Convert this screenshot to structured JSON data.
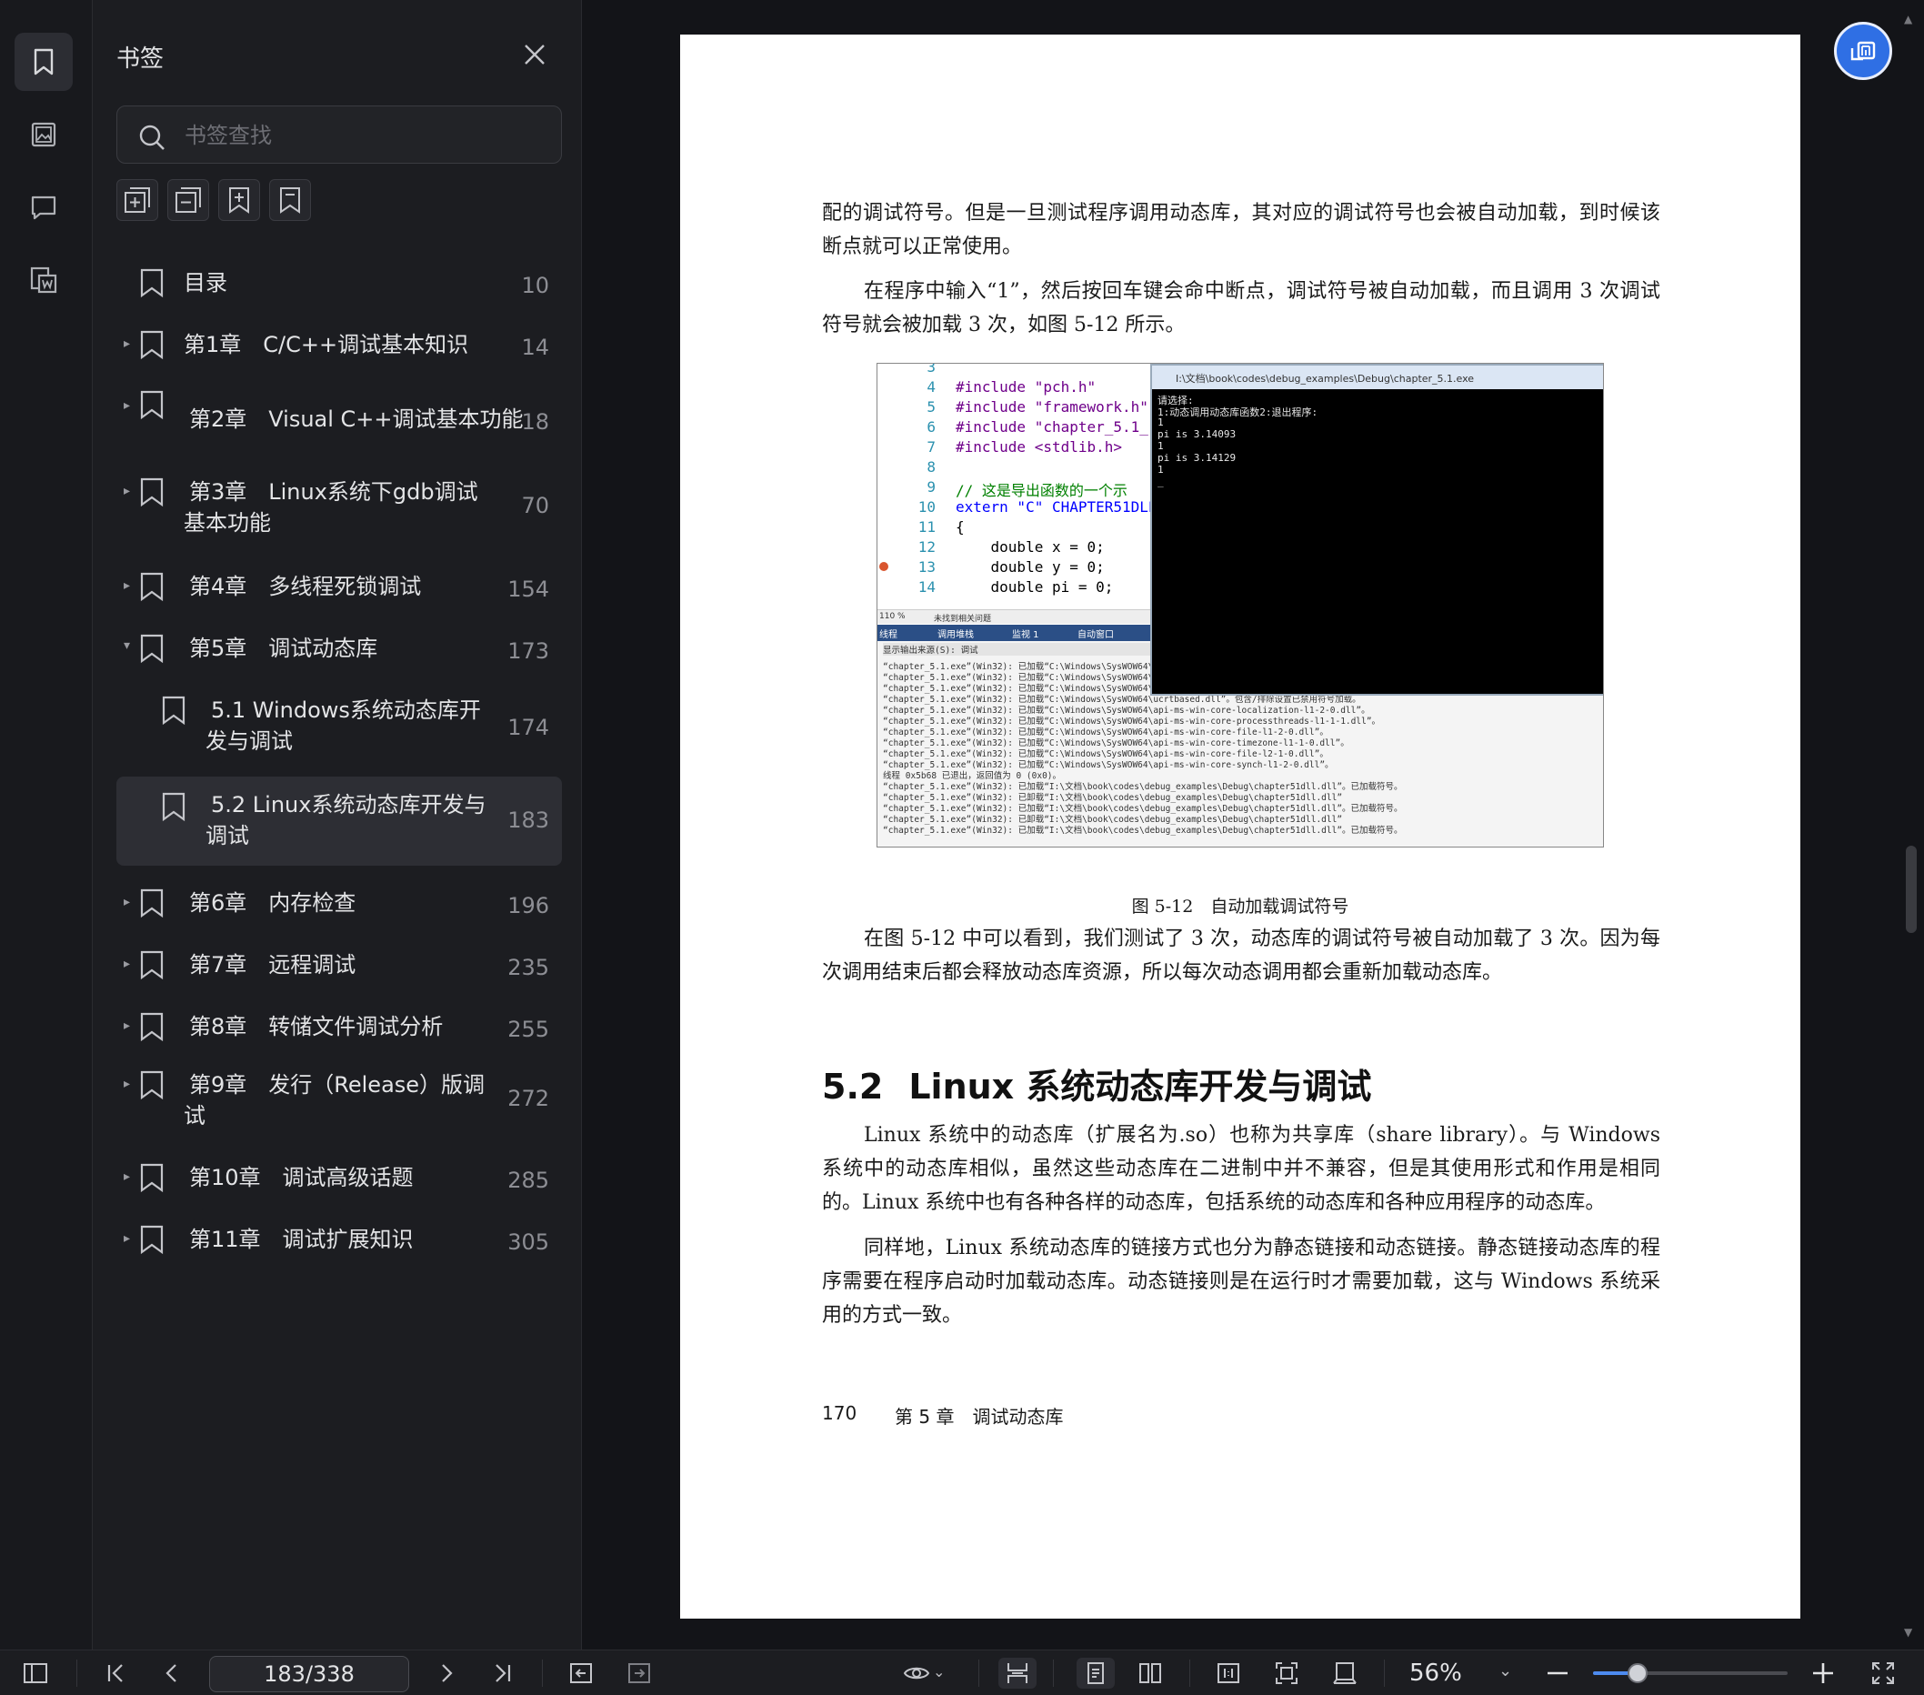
{
  "panel": {
    "title": "书签",
    "search_placeholder": "书签查找"
  },
  "bookmarks": [
    {
      "label": "目录",
      "page": "10",
      "expander": ""
    },
    {
      "label": "第1章　C/C++调试基本知识",
      "page": "14",
      "expander": "▸"
    },
    {
      "label": "第2章　Visual C++调试基本功能",
      "page": "18",
      "expander": "▸"
    },
    {
      "label": "第3章　Linux系统下gdb调试基本功能",
      "page": "70",
      "expander": "▸"
    },
    {
      "label": "第4章　多线程死锁调试",
      "page": "154",
      "expander": "▸"
    },
    {
      "label": "第5章　调试动态库",
      "page": "173",
      "expander": "▾"
    },
    {
      "label": "5.1 Windows系统动态库开发与调试",
      "page": "174",
      "expander": ""
    },
    {
      "label": "5.2 Linux系统动态库开发与调试",
      "page": "183",
      "expander": ""
    },
    {
      "label": "第6章　内存检查",
      "page": "196",
      "expander": "▸"
    },
    {
      "label": "第7章　远程调试",
      "page": "235",
      "expander": "▸"
    },
    {
      "label": "第8章　转储文件调试分析",
      "page": "255",
      "expander": "▸"
    },
    {
      "label": "第9章　发行（Release）版调试",
      "page": "272",
      "expander": "▸"
    },
    {
      "label": "第10章　调试高级话题",
      "page": "285",
      "expander": "▸"
    },
    {
      "label": "第11章　调试扩展知识",
      "page": "305",
      "expander": "▸"
    }
  ],
  "document": {
    "para1": "配的调试符号。但是一旦测试程序调用动态库，其对应的调试符号也会被自动加载，到时候该断点就可以正常使用。",
    "para2": "在程序中输入“1”，然后按回车键会命中断点，调试符号被自动加载，而且调用 3 次调试符号就会被加载 3 次，如图 5-12 所示。",
    "caption": "图 5-12　自动加载调试符号",
    "para3": "在图 5-12 中可以看到，我们测试了 3 次，动态库的调试符号被自动加载了 3 次。因为每次调用结束后都会释放动态库资源，所以每次动态调用都会重新加载动态库。",
    "heading_num": "5.2",
    "heading_text": "Linux 系统动态库开发与调试",
    "para4": "Linux 系统中的动态库（扩展名为.so）也称为共享库（share library）。与 Windows 系统中的动态库相似，虽然这些动态库在二进制中并不兼容，但是其使用形式和作用是相同的。Linux 系统中也有各种各样的动态库，包括系统的动态库和各种应用程序的动态库。",
    "para5": "同样地，Linux 系统动态库的链接方式也分为静态链接和动态链接。静态链接动态库的程序需要在程序启动时加载动态库。动态链接则是在运行时才需要加载，这与 Windows 系统采用的方式一致。",
    "footer_page": "170",
    "footer_chapter": "第 5 章　调试动态库"
  },
  "figure": {
    "code_lines": [
      {
        "n": "3",
        "t": ""
      },
      {
        "n": "4",
        "t": "#include \"pch.h\""
      },
      {
        "n": "5",
        "t": "#include \"framework.h\""
      },
      {
        "n": "6",
        "t": "#include \"chapter_5.1_"
      },
      {
        "n": "7",
        "t": "#include <stdlib.h>"
      },
      {
        "n": "8",
        "t": ""
      },
      {
        "n": "9",
        "t": "// 这是导出函数的一个示"
      },
      {
        "n": "10",
        "t": "extern \"C\" CHAPTER51DLL"
      },
      {
        "n": "11",
        "t": "{"
      },
      {
        "n": "12",
        "t": "    double x = 0;"
      },
      {
        "n": "13",
        "t": "    double y = 0;"
      },
      {
        "n": "14",
        "t": "    double pi = 0;"
      }
    ],
    "console_title": "I:\\文档\\book\\codes\\debug_examples\\Debug\\chapter_5.1.exe",
    "console_lines": [
      "请选择:",
      "1:动态调用动态库函数2:退出程序:",
      "1",
      "pi is 3.14093",
      "1",
      "pi is 3.14129",
      "1",
      "_"
    ],
    "status_zoom": "110 %",
    "status_msg": "未找到相关问题",
    "out_tabs": [
      "线程",
      "调用堆栈",
      "监视 1",
      "自动窗口"
    ],
    "out_source": "显示输出来源(S): 调试",
    "output_lines": [
      "“chapter_5.1.exe”(Win32): 已加载“C:\\Windows\\SysWOW64\\Ker",
      "“chapter_5.1.exe”(Win32): 已加载“C:\\Windows\\SysWOW64\\msv",
      "“chapter_5.1.exe”(Win32): 已加载“C:\\Windows\\SysWOW64\\ucr",
      "“chapter_5.1.exe”(Win32): 已加载“C:\\Windows\\SysWOW64\\ucrtbased.dll”。包含/排除设置已禁用符号加载。",
      "“chapter_5.1.exe”(Win32): 已加载“C:\\Windows\\SysWOW64\\api-ms-win-core-localization-l1-2-0.dll”。",
      "“chapter_5.1.exe”(Win32): 已加载“C:\\Windows\\SysWOW64\\api-ms-win-core-processthreads-l1-1-1.dll”。",
      "“chapter_5.1.exe”(Win32): 已加载“C:\\Windows\\SysWOW64\\api-ms-win-core-file-l1-2-0.dll”。",
      "“chapter_5.1.exe”(Win32): 已加载“C:\\Windows\\SysWOW64\\api-ms-win-core-timezone-l1-1-0.dll”。",
      "“chapter_5.1.exe”(Win32): 已加载“C:\\Windows\\SysWOW64\\api-ms-win-core-file-l2-1-0.dll”。",
      "“chapter_5.1.exe”(Win32): 已加载“C:\\Windows\\SysWOW64\\api-ms-win-core-synch-l1-2-0.dll”。",
      "线程 0x5b68 已退出，返回值为 0 (0x0)。",
      "“chapter_5.1.exe”(Win32): 已加载“I:\\文档\\book\\codes\\debug_examples\\Debug\\chapter51dll.dll”。已加载符号。",
      "“chapter_5.1.exe”(Win32): 已卸载“I:\\文档\\book\\codes\\debug_examples\\Debug\\chapter51dll.dll”",
      "“chapter_5.1.exe”(Win32): 已加载“I:\\文档\\book\\codes\\debug_examples\\Debug\\chapter51dll.dll”。已加载符号。",
      "“chapter_5.1.exe”(Win32): 已卸载“I:\\文档\\book\\codes\\debug_examples\\Debug\\chapter51dll.dll”",
      "“chapter_5.1.exe”(Win32): 已加载“I:\\文档\\book\\codes\\debug_examples\\Debug\\chapter51dll.dll”。已加载符号。"
    ]
  },
  "toolbar": {
    "page_indicator": "183/338",
    "zoom": "56%",
    "zoom_fraction": 0.23
  },
  "colors": {
    "accent": "#2f6fe4",
    "slider_fill": "#4d8bf0",
    "selected_bg": "#2d2e34"
  },
  "icons": [
    "bookmark-icon",
    "image-icon",
    "comment-icon",
    "outline-icon",
    "close-icon",
    "search-icon",
    "expand-all-icon",
    "collapse-all-icon",
    "add-bookmark-icon",
    "bookmark-current-icon",
    "translate-icon"
  ]
}
